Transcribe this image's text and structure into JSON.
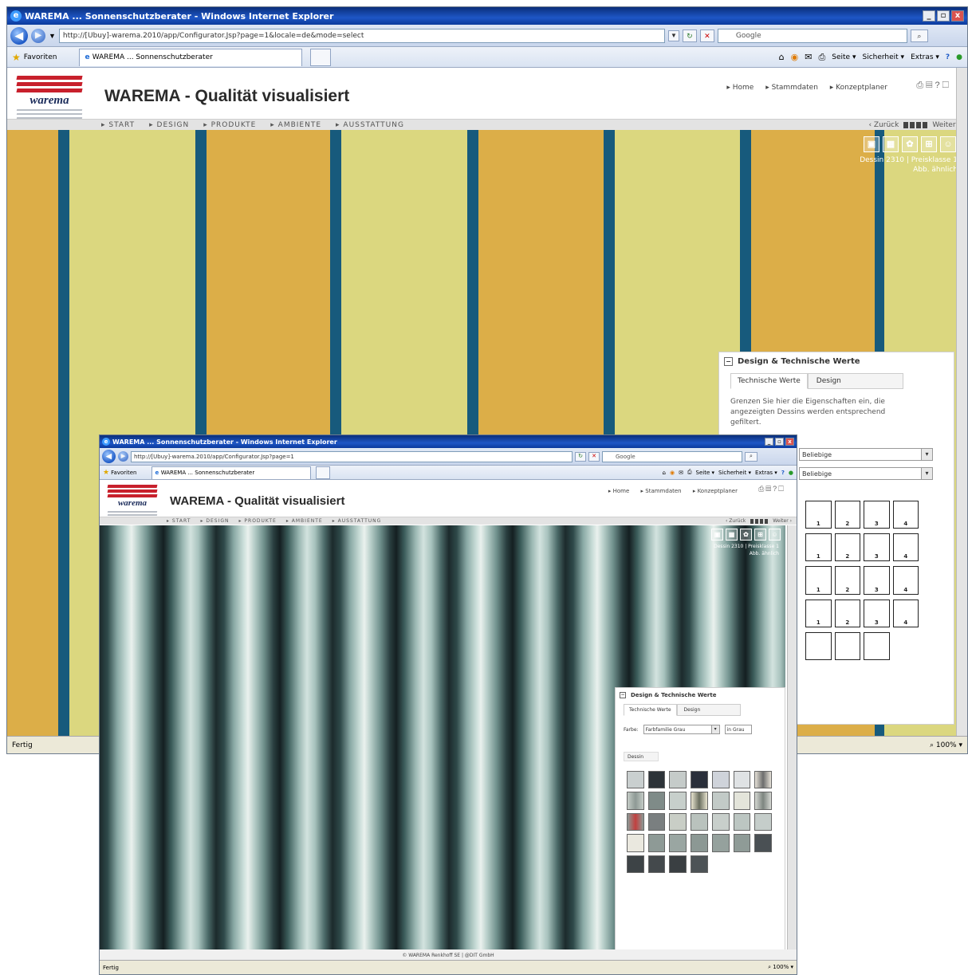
{
  "back_window": {
    "title": "WAREMA ... Sonnenschutzberater - Windows Internet Explorer",
    "window_controls": [
      "_",
      "▫",
      "x"
    ],
    "url": "http://[Ubuy]-warema.2010/app/Configurator.Jsp?page=1&locale=de&mode=select",
    "search_placeholder": "Google",
    "favorites_label": "Favoriten",
    "tab_label": "WAREMA ... Sonnenschutzberater",
    "commands": [
      "Seite ▾",
      "Sicherheit ▾",
      "Extras ▾"
    ],
    "site_title": "WAREMA - Qualität visualisiert",
    "logo_text": "warema",
    "top_links": [
      "▸ Home",
      "▸ Stammdaten",
      "▸ Konzeptplaner"
    ],
    "nav": [
      "▸ START",
      "▸ DESIGN",
      "▸ PRODUKTE",
      "▸ AMBIENTE",
      "▸ AUSSTATTUNG"
    ],
    "back_label": "‹ Zurück",
    "next_label": "Weiter ›",
    "dessin_line1": "Dessin 2310 | Preisklasse 1",
    "dessin_line2": "Abb. ähnlich",
    "panel": {
      "title": "Design & Technische Werte",
      "tab_active": "Technische Werte",
      "tab_other": "Design",
      "description": "Grenzen Sie hier die Eigenschaften ein, die angezeigten Dessins werden entsprechend gefiltert.",
      "select1": "Beliebige",
      "select2": "Beliebige",
      "icon_numbers": [
        "1",
        "2",
        "3",
        "4"
      ]
    },
    "status_left": "Fertig",
    "status_zoom": "100%",
    "colors": {
      "stripe_gold": "#dcae48",
      "stripe_pale": "#dbd77f",
      "stripe_blue": "#175a7c"
    }
  },
  "front_window": {
    "title": "WAREMA ... Sonnenschutzberater - Windows Internet Explorer",
    "url": "http://[Ubuy]-warema.2010/app/Configurator.Jsp?page=1",
    "search_placeholder": "Google",
    "favorites_label": "Favoriten",
    "tab_label": "WAREMA ... Sonnenschutzberater",
    "commands": [
      "Seite ▾",
      "Sicherheit ▾",
      "Extras ▾"
    ],
    "site_title": "WAREMA - Qualität visualisiert",
    "logo_text": "warema",
    "top_links": [
      "▸ Home",
      "▸ Stammdaten",
      "▸ Konzeptplaner"
    ],
    "nav": [
      "▸ START",
      "▸ DESIGN",
      "▸ PRODUKTE",
      "▸ AMBIENTE",
      "▸ AUSSTATTUNG"
    ],
    "back_label": "‹ Zurück",
    "next_label": "Weiter ›",
    "dessin_line1": "Dessin 2310 | Preisklasse 1",
    "dessin_line2": "Abb. ähnlich",
    "panel": {
      "title": "Design & Technische Werte",
      "tab_active": "Technische Werte",
      "tab_other": "Design",
      "farbe_label": "Farbe:",
      "farbe_value": "Farbfamilie Grau",
      "extra_value": "in Grau",
      "dessin_button": "Dessin"
    },
    "footer": "© WAREMA Renkhoff SE  |  @DIT GmbH",
    "status_left": "Fertig",
    "status_zoom": "100%"
  }
}
